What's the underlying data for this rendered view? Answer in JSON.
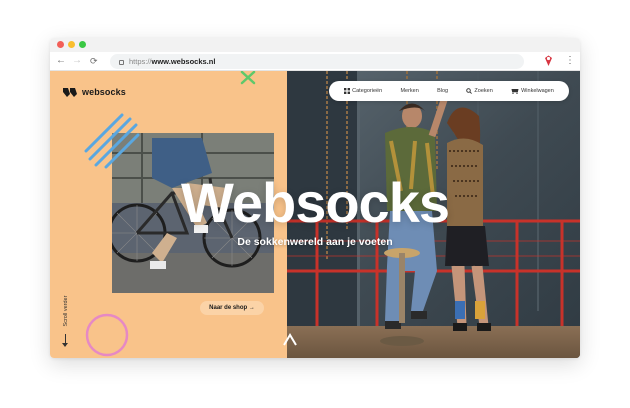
{
  "browser": {
    "url_protocol": "https://",
    "url_host": "www.websocks.nl",
    "icons": {
      "back": "arrow-left-icon",
      "forward": "arrow-right-icon",
      "reload": "reload-icon",
      "lock": "lock-icon",
      "extension": "extension-icon",
      "menu": "kebab-menu-icon"
    }
  },
  "site": {
    "logo_text": "websocks",
    "nav": [
      {
        "label": "Categorieën",
        "icon": "grid-icon"
      },
      {
        "label": "Merken",
        "icon": ""
      },
      {
        "label": "Blog",
        "icon": ""
      },
      {
        "label": "Zoeken",
        "icon": "search-icon"
      },
      {
        "label": "Winkelwagen",
        "icon": "cart-icon"
      }
    ],
    "hero": {
      "title": "Websocks",
      "subtitle": "De sokkenwereld aan je voeten",
      "cta_label": "Naar de shop →"
    },
    "scroll_label": "Scroll verder"
  },
  "colors": {
    "peach": "#f9c38a",
    "accent_blue": "#5aa7e0",
    "accent_pink": "#e689c4",
    "accent_green": "#5ec86b"
  }
}
